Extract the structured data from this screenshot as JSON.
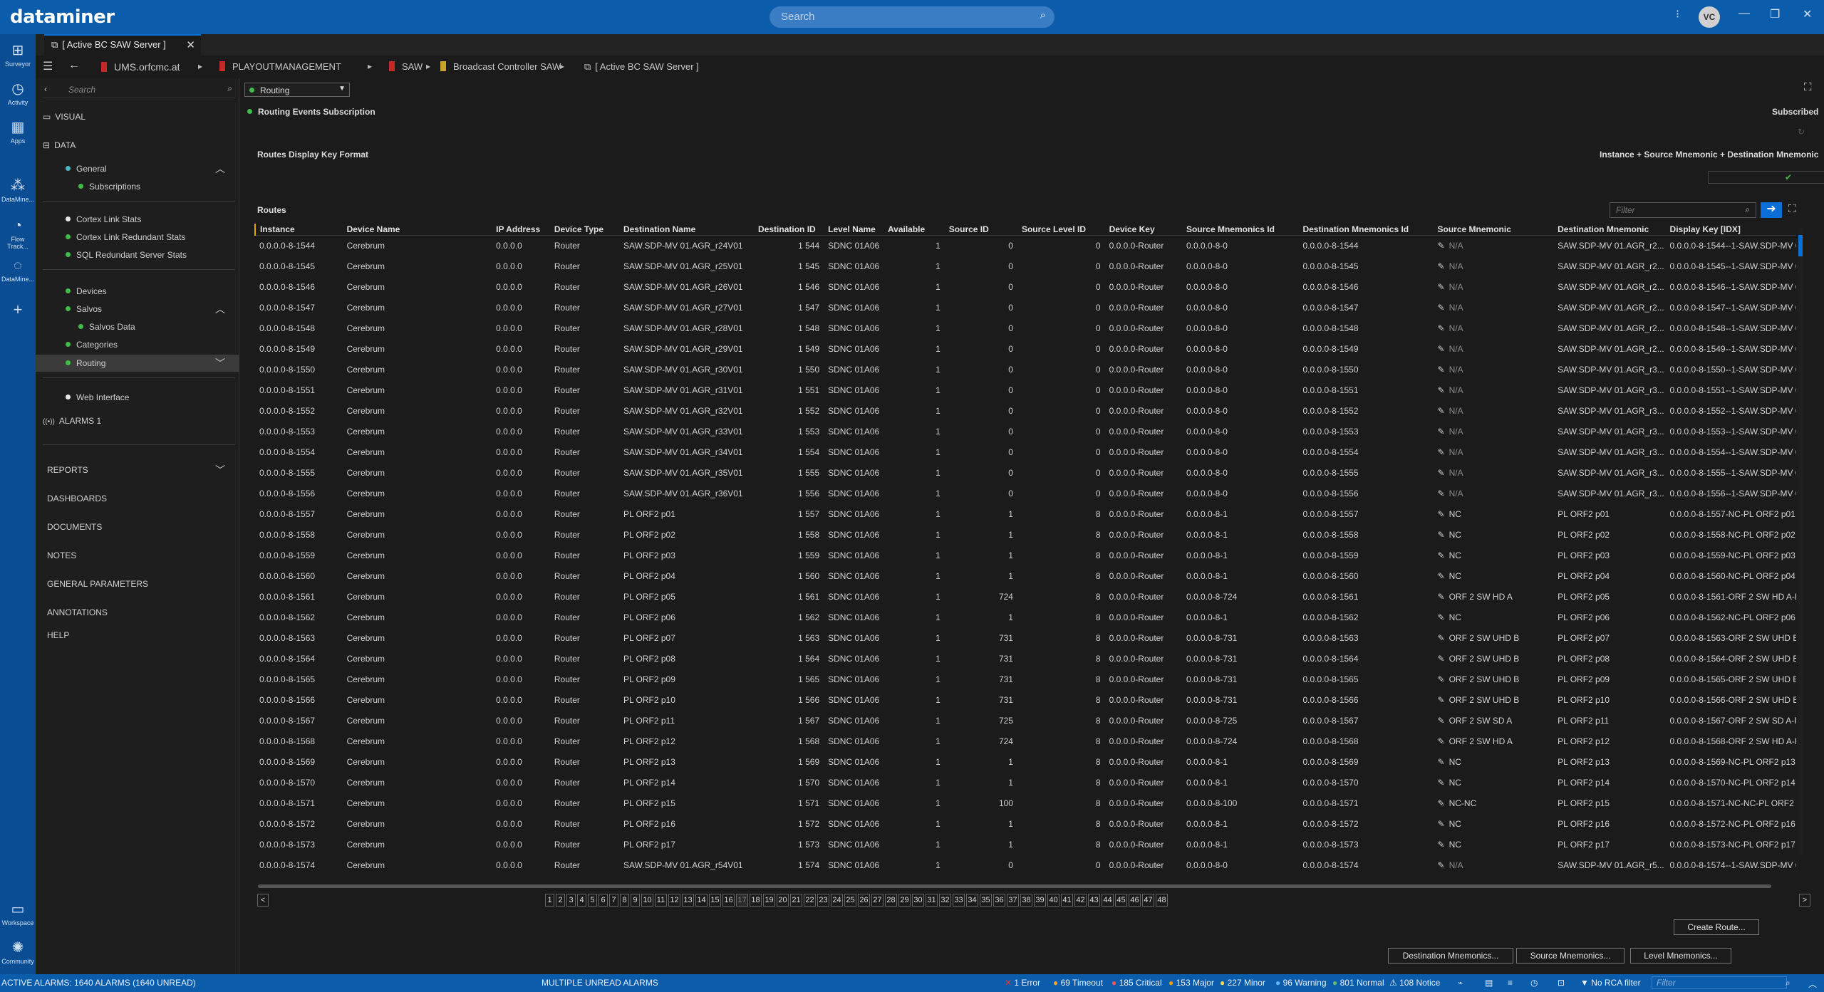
{
  "app": {
    "logo": "dataminer",
    "search_placeholder": "Search",
    "user_initials": "VC"
  },
  "rail": [
    {
      "label": "Surveyor",
      "icon": "surveyor-icon",
      "glyph": "⊞"
    },
    {
      "label": "Activity",
      "icon": "activity-icon",
      "glyph": "◷"
    },
    {
      "label": "Apps",
      "icon": "apps-icon",
      "glyph": "▦"
    },
    {
      "label": "DataMine...",
      "icon": "datamine-icon",
      "glyph": "⁂"
    },
    {
      "label": "Flow Track...",
      "icon": "flow-tracking-icon",
      "glyph": "◔"
    },
    {
      "label": "DataMine...",
      "icon": "datamine-icon",
      "glyph": "◌"
    },
    {
      "label": "Workspace",
      "icon": "workspace-icon",
      "glyph": "▭"
    },
    {
      "label": "Community",
      "icon": "community-icon",
      "glyph": "✺"
    }
  ],
  "tab": {
    "label": "[ Active BC SAW Server ]"
  },
  "breadcrumb": [
    "UMS.orfcmc.at",
    "PLAYOUTMANAGEMENT",
    "SAW",
    "Broadcast Controller SAW",
    "[ Active BC SAW Server ]"
  ],
  "sidebar": {
    "search_placeholder": "Search",
    "visual": "VISUAL",
    "data": "DATA",
    "items": {
      "general": "General",
      "subscriptions": "Subscriptions",
      "cortex_link": "Cortex Link Stats",
      "cortex_red": "Cortex Link Redundant Stats",
      "sql_red": "SQL Redundant Server Stats",
      "devices": "Devices",
      "salvos": "Salvos",
      "salvos_data": "Salvos Data",
      "categories": "Categories",
      "routing": "Routing",
      "web": "Web Interface",
      "alarms": "ALARMS 1",
      "reports": "REPORTS",
      "dashboards": "DASHBOARDS",
      "documents": "DOCUMENTS",
      "notes": "NOTES",
      "general_params": "GENERAL PARAMETERS",
      "annotations": "ANNOTATIONS",
      "help": "HELP"
    }
  },
  "content": {
    "page_select": "Routing",
    "subscription_label": "Routing Events Subscription",
    "subscription_state": "Subscribed",
    "key_format_label": "Routes Display Key Format",
    "key_format_value": "Instance + Source Mnemonic + Destination Mnemonic",
    "routes_label": "Routes",
    "filter_placeholder": "Filter"
  },
  "table": {
    "columns": [
      "Instance",
      "Device Name",
      "IP Address",
      "Device Type",
      "Destination Name",
      "Destination ID",
      "Level Name",
      "Available",
      "Source ID",
      "Source Level ID",
      "Device Key",
      "Source Mnemonics Id",
      "Destination Mnemonics Id",
      "Source Mnemonic",
      "Destination Mnemonic",
      "Display Key [IDX]"
    ],
    "rows": [
      [
        "0.0.0.0-8-1544",
        "Cerebrum",
        "0.0.0.0",
        "Router",
        "SAW.SDP-MV 01.AGR_r24V01",
        "1 544",
        "SDNC 01A06",
        "1",
        "0",
        "0",
        "0.0.0.0-Router",
        "0.0.0.0-8-0",
        "0.0.0.0-8-1544",
        "N/A",
        "SAW.SDP-MV 01.AGR_r2...",
        "0.0.0.0-8-1544--1-SAW.SDP-MV 0"
      ],
      [
        "0.0.0.0-8-1545",
        "Cerebrum",
        "0.0.0.0",
        "Router",
        "SAW.SDP-MV 01.AGR_r25V01",
        "1 545",
        "SDNC 01A06",
        "1",
        "0",
        "0",
        "0.0.0.0-Router",
        "0.0.0.0-8-0",
        "0.0.0.0-8-1545",
        "N/A",
        "SAW.SDP-MV 01.AGR_r2...",
        "0.0.0.0-8-1545--1-SAW.SDP-MV 0"
      ],
      [
        "0.0.0.0-8-1546",
        "Cerebrum",
        "0.0.0.0",
        "Router",
        "SAW.SDP-MV 01.AGR_r26V01",
        "1 546",
        "SDNC 01A06",
        "1",
        "0",
        "0",
        "0.0.0.0-Router",
        "0.0.0.0-8-0",
        "0.0.0.0-8-1546",
        "N/A",
        "SAW.SDP-MV 01.AGR_r2...",
        "0.0.0.0-8-1546--1-SAW.SDP-MV 0"
      ],
      [
        "0.0.0.0-8-1547",
        "Cerebrum",
        "0.0.0.0",
        "Router",
        "SAW.SDP-MV 01.AGR_r27V01",
        "1 547",
        "SDNC 01A06",
        "1",
        "0",
        "0",
        "0.0.0.0-Router",
        "0.0.0.0-8-0",
        "0.0.0.0-8-1547",
        "N/A",
        "SAW.SDP-MV 01.AGR_r2...",
        "0.0.0.0-8-1547--1-SAW.SDP-MV 0"
      ],
      [
        "0.0.0.0-8-1548",
        "Cerebrum",
        "0.0.0.0",
        "Router",
        "SAW.SDP-MV 01.AGR_r28V01",
        "1 548",
        "SDNC 01A06",
        "1",
        "0",
        "0",
        "0.0.0.0-Router",
        "0.0.0.0-8-0",
        "0.0.0.0-8-1548",
        "N/A",
        "SAW.SDP-MV 01.AGR_r2...",
        "0.0.0.0-8-1548--1-SAW.SDP-MV 0"
      ],
      [
        "0.0.0.0-8-1549",
        "Cerebrum",
        "0.0.0.0",
        "Router",
        "SAW.SDP-MV 01.AGR_r29V01",
        "1 549",
        "SDNC 01A06",
        "1",
        "0",
        "0",
        "0.0.0.0-Router",
        "0.0.0.0-8-0",
        "0.0.0.0-8-1549",
        "N/A",
        "SAW.SDP-MV 01.AGR_r2...",
        "0.0.0.0-8-1549--1-SAW.SDP-MV 0"
      ],
      [
        "0.0.0.0-8-1550",
        "Cerebrum",
        "0.0.0.0",
        "Router",
        "SAW.SDP-MV 01.AGR_r30V01",
        "1 550",
        "SDNC 01A06",
        "1",
        "0",
        "0",
        "0.0.0.0-Router",
        "0.0.0.0-8-0",
        "0.0.0.0-8-1550",
        "N/A",
        "SAW.SDP-MV 01.AGR_r3...",
        "0.0.0.0-8-1550--1-SAW.SDP-MV 0"
      ],
      [
        "0.0.0.0-8-1551",
        "Cerebrum",
        "0.0.0.0",
        "Router",
        "SAW.SDP-MV 01.AGR_r31V01",
        "1 551",
        "SDNC 01A06",
        "1",
        "0",
        "0",
        "0.0.0.0-Router",
        "0.0.0.0-8-0",
        "0.0.0.0-8-1551",
        "N/A",
        "SAW.SDP-MV 01.AGR_r3...",
        "0.0.0.0-8-1551--1-SAW.SDP-MV 0"
      ],
      [
        "0.0.0.0-8-1552",
        "Cerebrum",
        "0.0.0.0",
        "Router",
        "SAW.SDP-MV 01.AGR_r32V01",
        "1 552",
        "SDNC 01A06",
        "1",
        "0",
        "0",
        "0.0.0.0-Router",
        "0.0.0.0-8-0",
        "0.0.0.0-8-1552",
        "N/A",
        "SAW.SDP-MV 01.AGR_r3...",
        "0.0.0.0-8-1552--1-SAW.SDP-MV 0"
      ],
      [
        "0.0.0.0-8-1553",
        "Cerebrum",
        "0.0.0.0",
        "Router",
        "SAW.SDP-MV 01.AGR_r33V01",
        "1 553",
        "SDNC 01A06",
        "1",
        "0",
        "0",
        "0.0.0.0-Router",
        "0.0.0.0-8-0",
        "0.0.0.0-8-1553",
        "N/A",
        "SAW.SDP-MV 01.AGR_r3...",
        "0.0.0.0-8-1553--1-SAW.SDP-MV 0"
      ],
      [
        "0.0.0.0-8-1554",
        "Cerebrum",
        "0.0.0.0",
        "Router",
        "SAW.SDP-MV 01.AGR_r34V01",
        "1 554",
        "SDNC 01A06",
        "1",
        "0",
        "0",
        "0.0.0.0-Router",
        "0.0.0.0-8-0",
        "0.0.0.0-8-1554",
        "N/A",
        "SAW.SDP-MV 01.AGR_r3...",
        "0.0.0.0-8-1554--1-SAW.SDP-MV 0"
      ],
      [
        "0.0.0.0-8-1555",
        "Cerebrum",
        "0.0.0.0",
        "Router",
        "SAW.SDP-MV 01.AGR_r35V01",
        "1 555",
        "SDNC 01A06",
        "1",
        "0",
        "0",
        "0.0.0.0-Router",
        "0.0.0.0-8-0",
        "0.0.0.0-8-1555",
        "N/A",
        "SAW.SDP-MV 01.AGR_r3...",
        "0.0.0.0-8-1555--1-SAW.SDP-MV 0"
      ],
      [
        "0.0.0.0-8-1556",
        "Cerebrum",
        "0.0.0.0",
        "Router",
        "SAW.SDP-MV 01.AGR_r36V01",
        "1 556",
        "SDNC 01A06",
        "1",
        "0",
        "0",
        "0.0.0.0-Router",
        "0.0.0.0-8-0",
        "0.0.0.0-8-1556",
        "N/A",
        "SAW.SDP-MV 01.AGR_r3...",
        "0.0.0.0-8-1556--1-SAW.SDP-MV 0"
      ],
      [
        "0.0.0.0-8-1557",
        "Cerebrum",
        "0.0.0.0",
        "Router",
        "PL ORF2 p01",
        "1 557",
        "SDNC 01A06",
        "1",
        "1",
        "8",
        "0.0.0.0-Router",
        "0.0.0.0-8-1",
        "0.0.0.0-8-1557",
        "NC",
        "PL ORF2 p01",
        "0.0.0.0-8-1557-NC-PL ORF2 p01"
      ],
      [
        "0.0.0.0-8-1558",
        "Cerebrum",
        "0.0.0.0",
        "Router",
        "PL ORF2 p02",
        "1 558",
        "SDNC 01A06",
        "1",
        "1",
        "8",
        "0.0.0.0-Router",
        "0.0.0.0-8-1",
        "0.0.0.0-8-1558",
        "NC",
        "PL ORF2 p02",
        "0.0.0.0-8-1558-NC-PL ORF2 p02"
      ],
      [
        "0.0.0.0-8-1559",
        "Cerebrum",
        "0.0.0.0",
        "Router",
        "PL ORF2 p03",
        "1 559",
        "SDNC 01A06",
        "1",
        "1",
        "8",
        "0.0.0.0-Router",
        "0.0.0.0-8-1",
        "0.0.0.0-8-1559",
        "NC",
        "PL ORF2 p03",
        "0.0.0.0-8-1559-NC-PL ORF2 p03"
      ],
      [
        "0.0.0.0-8-1560",
        "Cerebrum",
        "0.0.0.0",
        "Router",
        "PL ORF2 p04",
        "1 560",
        "SDNC 01A06",
        "1",
        "1",
        "8",
        "0.0.0.0-Router",
        "0.0.0.0-8-1",
        "0.0.0.0-8-1560",
        "NC",
        "PL ORF2 p04",
        "0.0.0.0-8-1560-NC-PL ORF2 p04"
      ],
      [
        "0.0.0.0-8-1561",
        "Cerebrum",
        "0.0.0.0",
        "Router",
        "PL ORF2 p05",
        "1 561",
        "SDNC 01A06",
        "1",
        "724",
        "8",
        "0.0.0.0-Router",
        "0.0.0.0-8-724",
        "0.0.0.0-8-1561",
        "ORF 2 SW HD A",
        "PL ORF2 p05",
        "0.0.0.0-8-1561-ORF 2 SW HD A-P"
      ],
      [
        "0.0.0.0-8-1562",
        "Cerebrum",
        "0.0.0.0",
        "Router",
        "PL ORF2 p06",
        "1 562",
        "SDNC 01A06",
        "1",
        "1",
        "8",
        "0.0.0.0-Router",
        "0.0.0.0-8-1",
        "0.0.0.0-8-1562",
        "NC",
        "PL ORF2 p06",
        "0.0.0.0-8-1562-NC-PL ORF2 p06"
      ],
      [
        "0.0.0.0-8-1563",
        "Cerebrum",
        "0.0.0.0",
        "Router",
        "PL ORF2 p07",
        "1 563",
        "SDNC 01A06",
        "1",
        "731",
        "8",
        "0.0.0.0-Router",
        "0.0.0.0-8-731",
        "0.0.0.0-8-1563",
        "ORF 2 SW UHD B",
        "PL ORF2 p07",
        "0.0.0.0-8-1563-ORF 2 SW UHD B-"
      ],
      [
        "0.0.0.0-8-1564",
        "Cerebrum",
        "0.0.0.0",
        "Router",
        "PL ORF2 p08",
        "1 564",
        "SDNC 01A06",
        "1",
        "731",
        "8",
        "0.0.0.0-Router",
        "0.0.0.0-8-731",
        "0.0.0.0-8-1564",
        "ORF 2 SW UHD B",
        "PL ORF2 p08",
        "0.0.0.0-8-1564-ORF 2 SW UHD B-"
      ],
      [
        "0.0.0.0-8-1565",
        "Cerebrum",
        "0.0.0.0",
        "Router",
        "PL ORF2 p09",
        "1 565",
        "SDNC 01A06",
        "1",
        "731",
        "8",
        "0.0.0.0-Router",
        "0.0.0.0-8-731",
        "0.0.0.0-8-1565",
        "ORF 2 SW UHD B",
        "PL ORF2 p09",
        "0.0.0.0-8-1565-ORF 2 SW UHD B-"
      ],
      [
        "0.0.0.0-8-1566",
        "Cerebrum",
        "0.0.0.0",
        "Router",
        "PL ORF2 p10",
        "1 566",
        "SDNC 01A06",
        "1",
        "731",
        "8",
        "0.0.0.0-Router",
        "0.0.0.0-8-731",
        "0.0.0.0-8-1566",
        "ORF 2 SW UHD B",
        "PL ORF2 p10",
        "0.0.0.0-8-1566-ORF 2 SW UHD B-"
      ],
      [
        "0.0.0.0-8-1567",
        "Cerebrum",
        "0.0.0.0",
        "Router",
        "PL ORF2 p11",
        "1 567",
        "SDNC 01A06",
        "1",
        "725",
        "8",
        "0.0.0.0-Router",
        "0.0.0.0-8-725",
        "0.0.0.0-8-1567",
        "ORF 2 SW SD A",
        "PL ORF2 p11",
        "0.0.0.0-8-1567-ORF 2 SW SD A-PI"
      ],
      [
        "0.0.0.0-8-1568",
        "Cerebrum",
        "0.0.0.0",
        "Router",
        "PL ORF2 p12",
        "1 568",
        "SDNC 01A06",
        "1",
        "724",
        "8",
        "0.0.0.0-Router",
        "0.0.0.0-8-724",
        "0.0.0.0-8-1568",
        "ORF 2 SW HD A",
        "PL ORF2 p12",
        "0.0.0.0-8-1568-ORF 2 SW HD A-P"
      ],
      [
        "0.0.0.0-8-1569",
        "Cerebrum",
        "0.0.0.0",
        "Router",
        "PL ORF2 p13",
        "1 569",
        "SDNC 01A06",
        "1",
        "1",
        "8",
        "0.0.0.0-Router",
        "0.0.0.0-8-1",
        "0.0.0.0-8-1569",
        "NC",
        "PL ORF2 p13",
        "0.0.0.0-8-1569-NC-PL ORF2 p13"
      ],
      [
        "0.0.0.0-8-1570",
        "Cerebrum",
        "0.0.0.0",
        "Router",
        "PL ORF2 p14",
        "1 570",
        "SDNC 01A06",
        "1",
        "1",
        "8",
        "0.0.0.0-Router",
        "0.0.0.0-8-1",
        "0.0.0.0-8-1570",
        "NC",
        "PL ORF2 p14",
        "0.0.0.0-8-1570-NC-PL ORF2 p14"
      ],
      [
        "0.0.0.0-8-1571",
        "Cerebrum",
        "0.0.0.0",
        "Router",
        "PL ORF2 p15",
        "1 571",
        "SDNC 01A06",
        "1",
        "100",
        "8",
        "0.0.0.0-Router",
        "0.0.0.0-8-100",
        "0.0.0.0-8-1571",
        "NC-NC",
        "PL ORF2 p15",
        "0.0.0.0-8-1571-NC-NC-PL ORF2 p"
      ],
      [
        "0.0.0.0-8-1572",
        "Cerebrum",
        "0.0.0.0",
        "Router",
        "PL ORF2 p16",
        "1 572",
        "SDNC 01A06",
        "1",
        "1",
        "8",
        "0.0.0.0-Router",
        "0.0.0.0-8-1",
        "0.0.0.0-8-1572",
        "NC",
        "PL ORF2 p16",
        "0.0.0.0-8-1572-NC-PL ORF2 p16"
      ],
      [
        "0.0.0.0-8-1573",
        "Cerebrum",
        "0.0.0.0",
        "Router",
        "PL ORF2 p17",
        "1 573",
        "SDNC 01A06",
        "1",
        "1",
        "8",
        "0.0.0.0-Router",
        "0.0.0.0-8-1",
        "0.0.0.0-8-1573",
        "NC",
        "PL ORF2 p17",
        "0.0.0.0-8-1573-NC-PL ORF2 p17"
      ],
      [
        "0.0.0.0-8-1574",
        "Cerebrum",
        "0.0.0.0",
        "Router",
        "SAW.SDP-MV 01.AGR_r54V01",
        "1 574",
        "SDNC 01A06",
        "1",
        "0",
        "0",
        "0.0.0.0-Router",
        "0.0.0.0-8-0",
        "0.0.0.0-8-1574",
        "N/A",
        "SAW.SDP-MV 01.AGR_r5...",
        "0.0.0.0-8-1574--1-SAW.SDP-MV 0"
      ]
    ]
  },
  "pager": {
    "prev": "<",
    "next": ">",
    "current": "17",
    "pages": [
      "1",
      "2",
      "3",
      "4",
      "5",
      "6",
      "7",
      "8",
      "9",
      "10",
      "11",
      "12",
      "13",
      "14",
      "15",
      "16",
      "17",
      "18",
      "19",
      "20",
      "21",
      "22",
      "23",
      "24",
      "25",
      "26",
      "27",
      "28",
      "29",
      "30",
      "31",
      "32",
      "33",
      "34",
      "35",
      "36",
      "37",
      "38",
      "39",
      "40",
      "41",
      "42",
      "43",
      "44",
      "45",
      "46",
      "47",
      "48"
    ]
  },
  "buttons": {
    "create_route": "Create Route...",
    "dest_mnemonics": "Destination Mnemonics...",
    "source_mnemonics": "Source Mnemonics...",
    "level_mnemonics": "Level Mnemonics..."
  },
  "status": {
    "active_alarms": "ACTIVE ALARMS: 1640 ALARMS (1640 UNREAD)",
    "multiple": "MULTIPLE UNREAD ALARMS",
    "error": "1 Error",
    "timeout": "69 Timeout",
    "critical": "185 Critical",
    "major": "153 Major",
    "minor": "227 Minor",
    "warning": "96 Warning",
    "normal": "801 Normal",
    "notice": "108 Notice",
    "rca": "No RCA filter",
    "filter_placeholder": "Filter"
  },
  "colors": {
    "accent": "#0b5cab",
    "green": "#3fbf4a",
    "error": "#e53935",
    "timeout": "#f5a623",
    "critical": "#ff5252",
    "major": "#ff9800",
    "minor": "#ffd54f",
    "warning": "#64b5f6",
    "normal": "#66bb6a"
  }
}
